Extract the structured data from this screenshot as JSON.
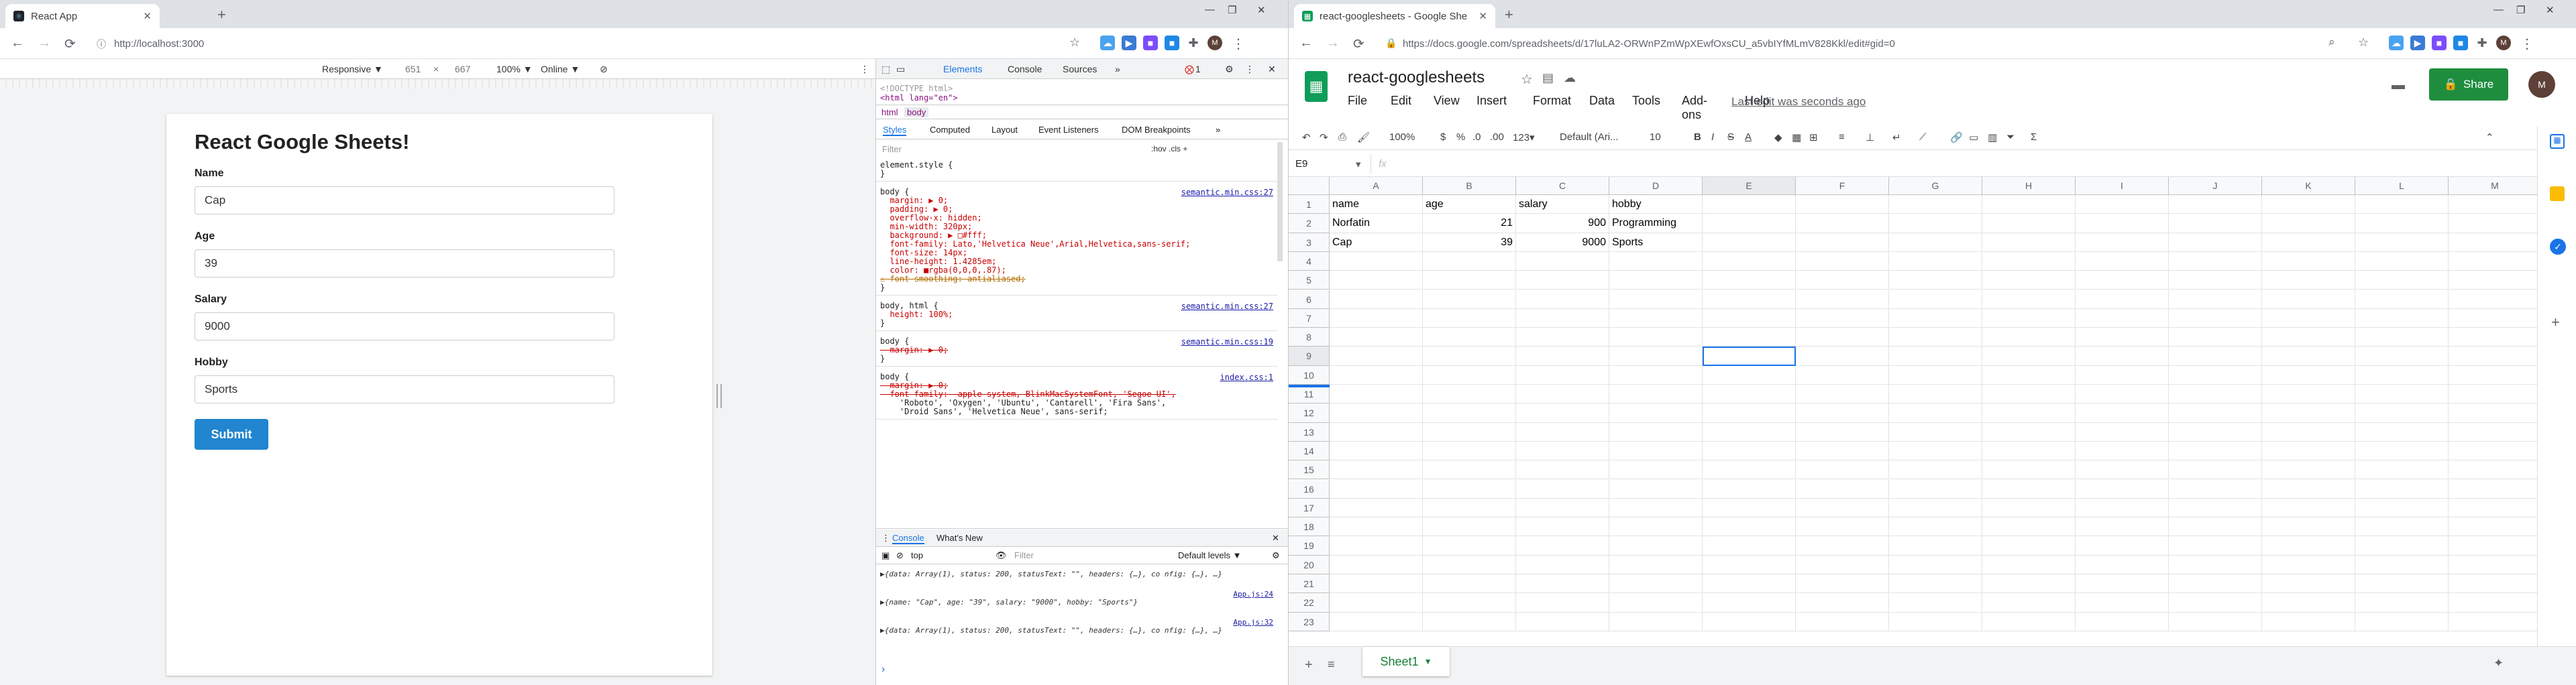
{
  "left_window": {
    "tab_title": "React App",
    "url": "http://localhost:3000",
    "device_toolbar": {
      "mode": "Responsive ▼",
      "width": "651",
      "height": "667",
      "zoom": "100% ▼",
      "network": "Online ▼"
    },
    "app": {
      "heading": "React Google Sheets!",
      "fields": [
        {
          "label": "Name",
          "value": "Cap"
        },
        {
          "label": "Age",
          "value": "39"
        },
        {
          "label": "Salary",
          "value": "9000"
        },
        {
          "label": "Hobby",
          "value": "Sports"
        }
      ],
      "submit_label": "Submit"
    },
    "devtools": {
      "tabs": [
        "Elements",
        "Console",
        "Sources",
        "»"
      ],
      "error_count": "1",
      "dom_lines": [
        "<!DOCTYPE html>",
        "<html lang=\"en\">"
      ],
      "crumbs": [
        "html",
        "body"
      ],
      "styles_tabs": [
        "Styles",
        "Computed",
        "Layout",
        "Event Listeners",
        "DOM Breakpoints",
        "»"
      ],
      "filter_placeholder": "Filter",
      "filter_flags": ":hov  .cls  +",
      "rules": [
        {
          "selector": "element.style {",
          "source": "",
          "decls": [
            "}"
          ]
        },
        {
          "selector": "body {",
          "source": "semantic.min.css:27",
          "decls": [
            "  margin: ▶ 0;",
            "  padding: ▶ 0;",
            "  overflow-x: hidden;",
            "  min-width: 320px;",
            "  background: ▶ □#fff;",
            "  font-family: Lato,'Helvetica Neue',Arial,Helvetica,sans-serif;",
            "  font-size: 14px;",
            "  line-height: 1.4285em;",
            "  color: ■rgba(0,0,0,.87);",
            "⚠ font-smoothing: antialiased;",
            "}"
          ]
        },
        {
          "selector": "body, html {",
          "source": "semantic.min.css:27",
          "decls": [
            "  height: 100%;",
            "}"
          ]
        },
        {
          "selector": "body {",
          "source": "semantic.min.css:19",
          "decls": [
            "  margin: ▶ 0;",
            "}"
          ]
        },
        {
          "selector": "body {",
          "source": "index.css:1",
          "decls": [
            "  margin: ▶ 0;",
            "  font-family: -apple-system, BlinkMacSystemFont, 'Segoe UI',",
            "    'Roboto', 'Oxygen', 'Ubuntu', 'Cantarell', 'Fira Sans',",
            "    'Droid Sans', 'Helvetica Neue', sans-serif;"
          ]
        }
      ],
      "console_tabs": [
        "Console",
        "What's New"
      ],
      "console_context": "top",
      "console_filter": "Filter",
      "console_levels": "Default levels ▼",
      "console_lines": [
        {
          "src": "",
          "text": "▶{data: Array(1), status: 200, statusText: \"\", headers: {…}, co nfig: {…}, …}"
        },
        {
          "src": "App.js:24",
          "text": "▶{name: \"Cap\", age: \"39\", salary: \"9000\", hobby: \"Sports\"}"
        },
        {
          "src": "App.js:32",
          "text": "▶{data: Array(1), status: 200, statusText: \"\", headers: {…}, co nfig: {…}, …}"
        }
      ],
      "prompt": "›"
    }
  },
  "right_window": {
    "tab_title": "react-googlesheets - Google She",
    "url": "https://docs.google.com/spreadsheets/d/17luLA2-ORWnPZmWpXEwfOxsCU_a5vbIYfMLmV828Kkl/edit#gid=0",
    "doc_title": "react-googlesheets",
    "menu": [
      "File",
      "Edit",
      "View",
      "Insert",
      "Format",
      "Data",
      "Tools",
      "Add-ons",
      "Help"
    ],
    "last_edit": "Last edit was seconds ago",
    "share_label": "Share",
    "toolbar": {
      "zoom": "100%",
      "currency": "$",
      "percent": "%",
      "dec0": ".0",
      "dec00": ".00",
      "numfmt": "123▾",
      "font": "Default (Ari...",
      "size": "10"
    },
    "name_box": "E9",
    "fx": "fx",
    "columns": [
      "A",
      "B",
      "C",
      "D",
      "E",
      "F",
      "G",
      "H",
      "I",
      "J",
      "K",
      "L",
      "M"
    ],
    "rows": [
      "1",
      "2",
      "3",
      "4",
      "5",
      "6",
      "7",
      "8",
      "9",
      "10",
      "11",
      "12",
      "13",
      "14",
      "15",
      "16",
      "17",
      "18",
      "19",
      "20",
      "21",
      "22",
      "23"
    ],
    "cells": [
      [
        "name",
        "age",
        "salary",
        "hobby"
      ],
      [
        "Norfatin",
        "21",
        "900",
        "Programming"
      ],
      [
        "Cap",
        "39",
        "9000",
        "Sports"
      ]
    ],
    "sheet_tab": "Sheet1"
  }
}
